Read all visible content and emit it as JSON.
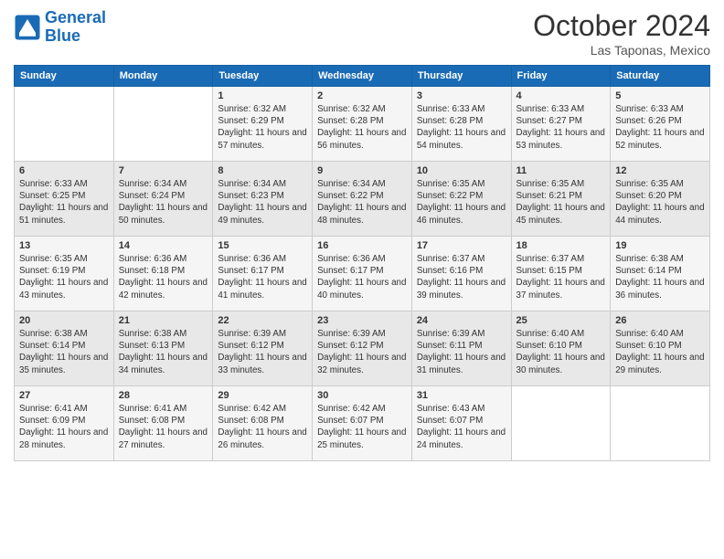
{
  "logo": {
    "text_general": "General",
    "text_blue": "Blue"
  },
  "header": {
    "month": "October 2024",
    "location": "Las Taponas, Mexico"
  },
  "weekdays": [
    "Sunday",
    "Monday",
    "Tuesday",
    "Wednesday",
    "Thursday",
    "Friday",
    "Saturday"
  ],
  "weeks": [
    [
      {
        "day": "",
        "info": ""
      },
      {
        "day": "",
        "info": ""
      },
      {
        "day": "1",
        "info": "Sunrise: 6:32 AM\nSunset: 6:29 PM\nDaylight: 11 hours and 57 minutes."
      },
      {
        "day": "2",
        "info": "Sunrise: 6:32 AM\nSunset: 6:28 PM\nDaylight: 11 hours and 56 minutes."
      },
      {
        "day": "3",
        "info": "Sunrise: 6:33 AM\nSunset: 6:28 PM\nDaylight: 11 hours and 54 minutes."
      },
      {
        "day": "4",
        "info": "Sunrise: 6:33 AM\nSunset: 6:27 PM\nDaylight: 11 hours and 53 minutes."
      },
      {
        "day": "5",
        "info": "Sunrise: 6:33 AM\nSunset: 6:26 PM\nDaylight: 11 hours and 52 minutes."
      }
    ],
    [
      {
        "day": "6",
        "info": "Sunrise: 6:33 AM\nSunset: 6:25 PM\nDaylight: 11 hours and 51 minutes."
      },
      {
        "day": "7",
        "info": "Sunrise: 6:34 AM\nSunset: 6:24 PM\nDaylight: 11 hours and 50 minutes."
      },
      {
        "day": "8",
        "info": "Sunrise: 6:34 AM\nSunset: 6:23 PM\nDaylight: 11 hours and 49 minutes."
      },
      {
        "day": "9",
        "info": "Sunrise: 6:34 AM\nSunset: 6:22 PM\nDaylight: 11 hours and 48 minutes."
      },
      {
        "day": "10",
        "info": "Sunrise: 6:35 AM\nSunset: 6:22 PM\nDaylight: 11 hours and 46 minutes."
      },
      {
        "day": "11",
        "info": "Sunrise: 6:35 AM\nSunset: 6:21 PM\nDaylight: 11 hours and 45 minutes."
      },
      {
        "day": "12",
        "info": "Sunrise: 6:35 AM\nSunset: 6:20 PM\nDaylight: 11 hours and 44 minutes."
      }
    ],
    [
      {
        "day": "13",
        "info": "Sunrise: 6:35 AM\nSunset: 6:19 PM\nDaylight: 11 hours and 43 minutes."
      },
      {
        "day": "14",
        "info": "Sunrise: 6:36 AM\nSunset: 6:18 PM\nDaylight: 11 hours and 42 minutes."
      },
      {
        "day": "15",
        "info": "Sunrise: 6:36 AM\nSunset: 6:17 PM\nDaylight: 11 hours and 41 minutes."
      },
      {
        "day": "16",
        "info": "Sunrise: 6:36 AM\nSunset: 6:17 PM\nDaylight: 11 hours and 40 minutes."
      },
      {
        "day": "17",
        "info": "Sunrise: 6:37 AM\nSunset: 6:16 PM\nDaylight: 11 hours and 39 minutes."
      },
      {
        "day": "18",
        "info": "Sunrise: 6:37 AM\nSunset: 6:15 PM\nDaylight: 11 hours and 37 minutes."
      },
      {
        "day": "19",
        "info": "Sunrise: 6:38 AM\nSunset: 6:14 PM\nDaylight: 11 hours and 36 minutes."
      }
    ],
    [
      {
        "day": "20",
        "info": "Sunrise: 6:38 AM\nSunset: 6:14 PM\nDaylight: 11 hours and 35 minutes."
      },
      {
        "day": "21",
        "info": "Sunrise: 6:38 AM\nSunset: 6:13 PM\nDaylight: 11 hours and 34 minutes."
      },
      {
        "day": "22",
        "info": "Sunrise: 6:39 AM\nSunset: 6:12 PM\nDaylight: 11 hours and 33 minutes."
      },
      {
        "day": "23",
        "info": "Sunrise: 6:39 AM\nSunset: 6:12 PM\nDaylight: 11 hours and 32 minutes."
      },
      {
        "day": "24",
        "info": "Sunrise: 6:39 AM\nSunset: 6:11 PM\nDaylight: 11 hours and 31 minutes."
      },
      {
        "day": "25",
        "info": "Sunrise: 6:40 AM\nSunset: 6:10 PM\nDaylight: 11 hours and 30 minutes."
      },
      {
        "day": "26",
        "info": "Sunrise: 6:40 AM\nSunset: 6:10 PM\nDaylight: 11 hours and 29 minutes."
      }
    ],
    [
      {
        "day": "27",
        "info": "Sunrise: 6:41 AM\nSunset: 6:09 PM\nDaylight: 11 hours and 28 minutes."
      },
      {
        "day": "28",
        "info": "Sunrise: 6:41 AM\nSunset: 6:08 PM\nDaylight: 11 hours and 27 minutes."
      },
      {
        "day": "29",
        "info": "Sunrise: 6:42 AM\nSunset: 6:08 PM\nDaylight: 11 hours and 26 minutes."
      },
      {
        "day": "30",
        "info": "Sunrise: 6:42 AM\nSunset: 6:07 PM\nDaylight: 11 hours and 25 minutes."
      },
      {
        "day": "31",
        "info": "Sunrise: 6:43 AM\nSunset: 6:07 PM\nDaylight: 11 hours and 24 minutes."
      },
      {
        "day": "",
        "info": ""
      },
      {
        "day": "",
        "info": ""
      }
    ]
  ]
}
